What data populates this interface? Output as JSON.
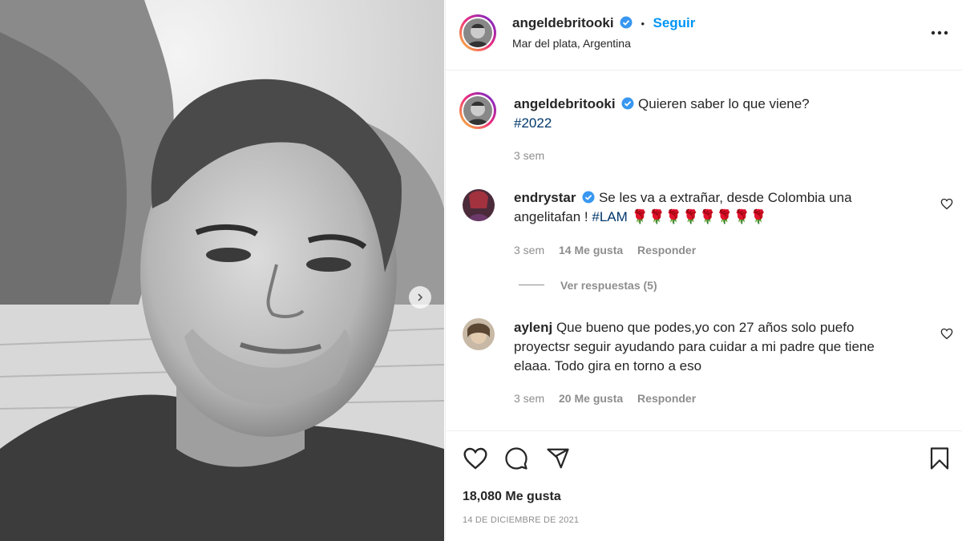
{
  "post": {
    "username": "angeldebritooki",
    "follow_label": "Seguir",
    "dot": "•",
    "location": "Mar del plata, Argentina",
    "caption": "Quieren saber lo que viene?",
    "hashtag": "#2022",
    "caption_time": "3 sem",
    "likes": "18,080 Me gusta",
    "date": "14 DE DICIEMBRE DE 2021",
    "more_icon": "more-horizontal-icon"
  },
  "comments": [
    {
      "username": "endrystar",
      "verified": true,
      "text": "Se les va a extrañar, desde Colombia una angelitafan !",
      "hashtag": "#LAM",
      "emoji": "🌹🌹🌹🌹🌹🌹🌹🌹",
      "time": "3 sem",
      "likes": "14 Me gusta",
      "reply": "Responder",
      "view_replies": "Ver respuestas (5)"
    },
    {
      "username": "aylenj",
      "verified": false,
      "text": "Que bueno que podes,yo con 27 años solo puefo proyectsr seguir ayudando para cuidar a mi padre que tiene elaaa. Todo gira en torno a eso",
      "time": "3 sem",
      "likes": "20 Me gusta",
      "reply": "Responder"
    }
  ],
  "colors": {
    "accent": "#0095f6",
    "verified": "#3897f0",
    "link": "#00376b",
    "secondary": "#8e8e8e"
  },
  "icons": [
    "heart-icon",
    "comment-icon",
    "share-icon",
    "bookmark-icon",
    "verified-icon",
    "next-arrow-icon"
  ]
}
